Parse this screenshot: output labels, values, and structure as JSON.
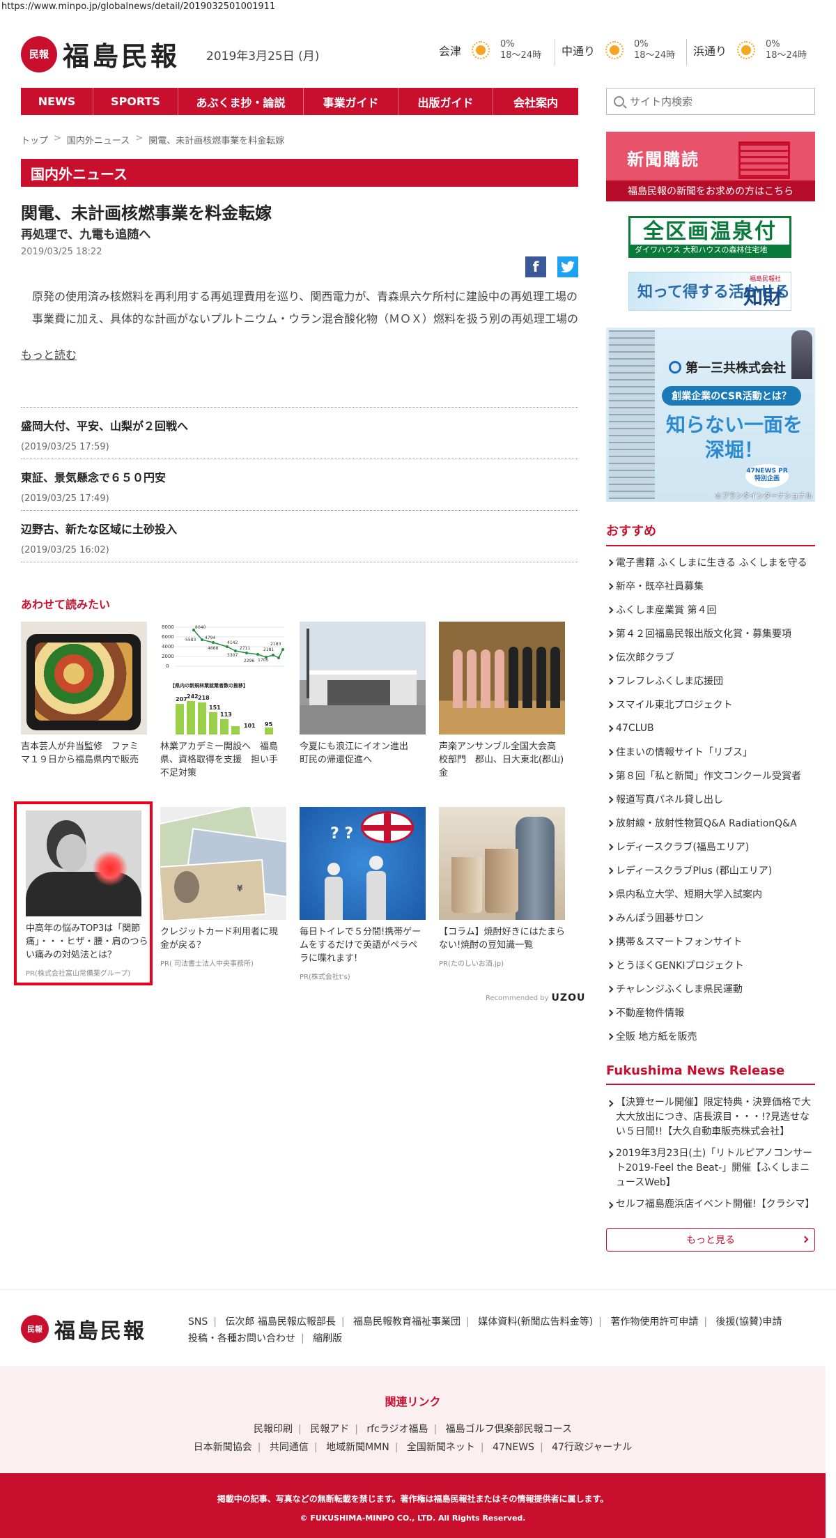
{
  "url": "https://www.minpo.jp/globalnews/detail/2019032501001911",
  "header": {
    "logo_seal": "民報",
    "logo_text": "福島民報",
    "date": "2019年3月25日 (月)",
    "weather": [
      {
        "region": "会津",
        "pct": "0%",
        "time": "18〜24時",
        "icon": "sun-icon"
      },
      {
        "region": "中通り",
        "pct": "0%",
        "time": "18〜24時",
        "icon": "sun-icon"
      },
      {
        "region": "浜通り",
        "pct": "0%",
        "time": "18〜24時",
        "icon": "sun-icon"
      }
    ]
  },
  "nav": [
    "NEWS",
    "SPORTS",
    "あぶくま抄・論説",
    "事業ガイド",
    "出版ガイド",
    "会社案内"
  ],
  "search": {
    "placeholder": "サイト内検索"
  },
  "breadcrumb": [
    "トップ",
    "国内外ニュース",
    "関電、未計画核燃事業を料金転嫁"
  ],
  "section_title": "国内外ニュース",
  "article": {
    "title": "関電、未計画核燃事業を料金転嫁",
    "subtitle": "再処理で、九電も追随へ",
    "date": "2019/03/25 18:22",
    "body": [
      "原発の使用済み核燃料を再利用する再処理費用を巡り、関西電力が、青森県六ケ所村に建設中の再処理工場の",
      "事業費に加え、具体的な計画がないプルトニウム・ウラン混合酸化物（ＭＯＸ）燃料を扱う別の再処理工場の費 …"
    ],
    "read_more": "もっと読む"
  },
  "news_list": [
    {
      "title": "盛岡大付、平安、山梨が２回戦へ",
      "date": "(2019/03/25 17:59)"
    },
    {
      "title": "東証、景気懸念で６５０円安",
      "date": "(2019/03/25 17:49)"
    },
    {
      "title": "辺野古、新たな区域に土砂投入",
      "date": "(2019/03/25 16:02)"
    }
  ],
  "related": {
    "heading": "あわせて読みたい",
    "cards": [
      {
        "caption": "吉本芸人が弁当監修　ファミマ１９日から福島県内で販売",
        "pr": ""
      },
      {
        "caption": "林業アカデミー開設へ　福島県、資格取得を支援　担い手不足対策",
        "pr": ""
      },
      {
        "caption": "今夏にも浪江にイオン進出　町民の帰還促進へ",
        "pr": ""
      },
      {
        "caption": "声楽アンサンブル全国大会高校部門　郡山、日大東北(郡山)金",
        "pr": ""
      },
      {
        "caption": "中高年の悩みTOP3は「関節痛」・・・ヒザ・腰・肩のつらい痛みの対処法とは？",
        "pr": "PR(株式会社富山常備薬グループ)"
      },
      {
        "caption": "クレジットカード利用者に現金が戻る？",
        "pr": "PR( 司法書士法人中央事務所)"
      },
      {
        "caption": "毎日トイレで５分間!携帯ゲームをするだけで英語がペラペラに喋れます!",
        "pr": "PR(株式会社t's)"
      },
      {
        "caption": "【コラム】焼酎好きにはたまらない!焼酎の豆知識一覧",
        "pr": "PR(たのしいお酒.jp)"
      }
    ],
    "chart_labels": {
      "title": "【県内の新規林業就業者数の推移】",
      "top_vals": [
        "8040",
        "5583",
        "4794",
        "4668",
        "4142",
        "3307",
        "2711",
        "2296",
        "2181",
        "1705",
        "2183"
      ],
      "bar_vals": [
        "207",
        "242",
        "218",
        "151",
        "113",
        "101",
        "95"
      ]
    },
    "recommended_by": "Recommended by",
    "recommended_brand": "UZOU"
  },
  "sidebar": {
    "subscribe_title": "新聞購読",
    "subscribe_sub": "福島民報の新聞をお求めの方はこちら",
    "ad1_title": "全区画温泉付",
    "ad1_sub": "ダイワハウス 大和ハウスの森林住宅地",
    "ad2_text": "知って得する活かせる",
    "ad2_key": "知財",
    "ad2_tag": "福島民報社",
    "ad3": {
      "company": "第一三共株式会社",
      "pill": "創業企業のCSR活動とは？",
      "big": "知らない一面を深堀！",
      "badge": "47NEWS PR特別企画",
      "credit": "©プランタインターナショナル"
    },
    "recommend_heading": "おすすめ",
    "recommend": [
      "電子書籍 ふくしまに生きる ふくしまを守る",
      "新卒・既卒社員募集",
      "ふくしま産業賞 第４回",
      "第４２回福島民報出版文化賞・募集要項",
      "伝次郎クラブ",
      "フレフレふくしま応援団",
      "スマイル東北プロジェクト",
      "47CLUB",
      "住まいの情報サイト「リブス」",
      "第８回「私と新聞」作文コンクール受賞者",
      "報道写真パネル貸し出し",
      "放射線・放射性物質Q&A RadiationQ&A",
      "レディースクラブ(福島エリア)",
      "レディースクラブPlus (郡山エリア)",
      "県内私立大学、短期大学入試案内",
      "みんぽう囲碁サロン",
      "携帯＆スマートフォンサイト",
      "とうほくGENKIプロジェクト",
      "チャレンジふくしま県民運動",
      "不動産物件情報",
      "全販 地方紙を販売"
    ],
    "release_heading": "Fukushima News Release",
    "releases": [
      "【決算セール開催】限定特典・決算価格で大大大放出につき、店長涙目・・・!?見逃せない５日間!!【大久自動車販売株式会社】",
      "2019年3月23日(土)「リトルピアノコンサート2019-Feel the Beat-」開催【ふくしまニュースWeb】",
      "セルフ福島鹿浜店イベント開催!【クラシマ】"
    ],
    "more": "もっと見る"
  },
  "footer": {
    "links_row1": [
      "SNS",
      "伝次郎 福島民報広報部長",
      "福島民報教育福祉事業団",
      "媒体資料(新聞広告料金等)",
      "著作物使用許可申請",
      "後援(協賛)申請"
    ],
    "links_row2": [
      "投稿・各種お問い合わせ",
      "縮刷版"
    ],
    "related_heading": "関連リンク",
    "related_row1": [
      "民報印刷",
      "民報アド",
      "rfcラジオ福島",
      "福島ゴルフ倶楽部民報コース"
    ],
    "related_row2": [
      "日本新聞協会",
      "共同通信",
      "地域新聞MMN",
      "全国新聞ネット",
      "47NEWS",
      "47行政ジャーナル"
    ],
    "notice": "掲載中の記事、写真などの無断転載を禁じます。著作権は福島民報社またはその情報提供者に属します。",
    "copyright": "© FUKUSHIMA-MINPO CO., LTD. All Rights Reserved."
  }
}
